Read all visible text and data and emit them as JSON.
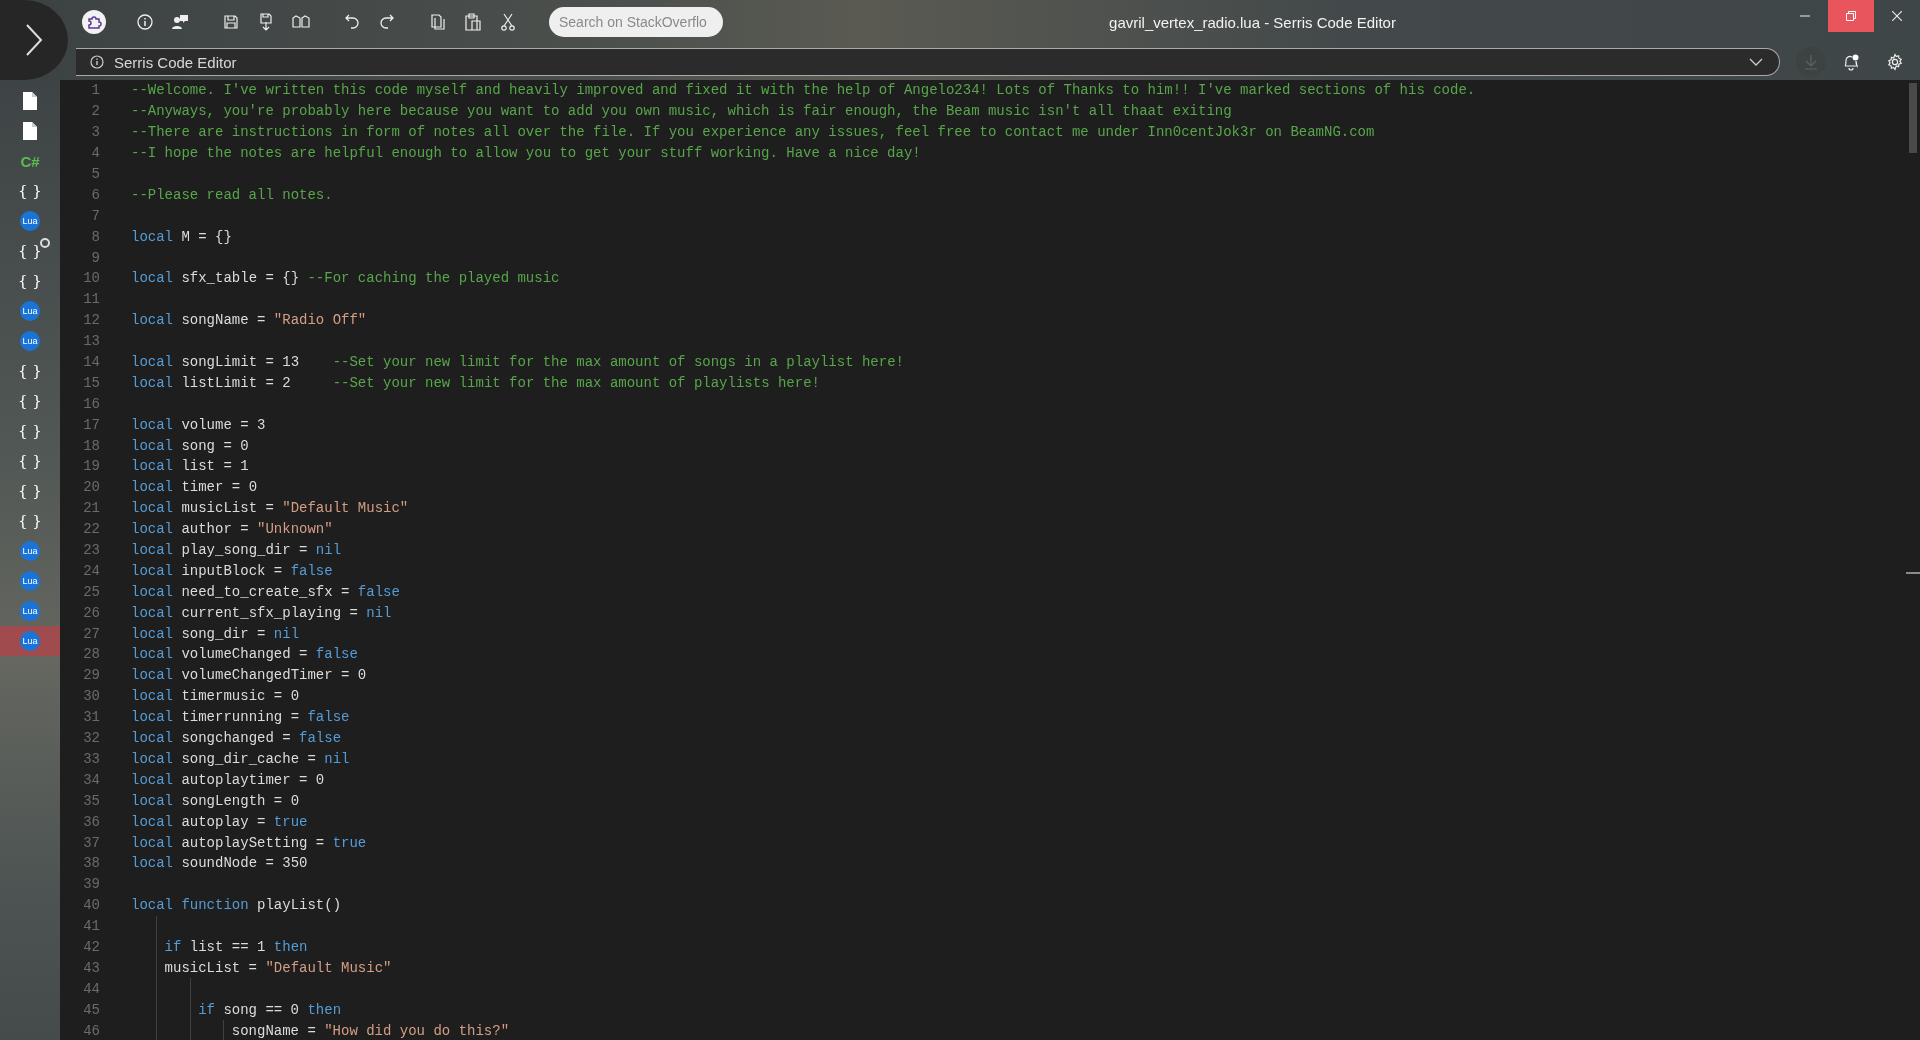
{
  "window": {
    "title": "gavril_vertex_radio.lua - Serris Code Editor"
  },
  "window_controls": [
    {
      "kind": "minimize",
      "hovered": false
    },
    {
      "kind": "restore",
      "hovered": true
    },
    {
      "kind": "close",
      "hovered": false
    }
  ],
  "toolbar": {
    "search": {
      "placeholder": "Search on StackOverflo"
    }
  },
  "address_bar": {
    "text": "Serris Code Editor"
  },
  "header_actions": {
    "download": {
      "disabled": true
    },
    "notifications": {
      "unread": true
    }
  },
  "sidebar": {
    "items": [
      {
        "kind": "file",
        "selected": false,
        "unsaved": false
      },
      {
        "kind": "file",
        "selected": false,
        "unsaved": false
      },
      {
        "kind": "csharp",
        "label": "C#",
        "selected": false,
        "unsaved": false
      },
      {
        "kind": "json",
        "label": "{ }",
        "selected": false,
        "unsaved": false
      },
      {
        "kind": "lua",
        "label": "Lua",
        "selected": false,
        "unsaved": false
      },
      {
        "kind": "json",
        "label": "{ }",
        "selected": false,
        "unsaved": true
      },
      {
        "kind": "json",
        "label": "{ }",
        "selected": false,
        "unsaved": false
      },
      {
        "kind": "lua",
        "label": "Lua",
        "selected": false,
        "unsaved": false
      },
      {
        "kind": "lua",
        "label": "Lua",
        "selected": false,
        "unsaved": false
      },
      {
        "kind": "json",
        "label": "{ }",
        "selected": false,
        "unsaved": false
      },
      {
        "kind": "json",
        "label": "{ }",
        "selected": false,
        "unsaved": false
      },
      {
        "kind": "json",
        "label": "{ }",
        "selected": false,
        "unsaved": false
      },
      {
        "kind": "json",
        "label": "{ }",
        "selected": false,
        "unsaved": false
      },
      {
        "kind": "json",
        "label": "{ }",
        "selected": false,
        "unsaved": false
      },
      {
        "kind": "json",
        "label": "{ }",
        "selected": false,
        "unsaved": false
      },
      {
        "kind": "lua",
        "label": "Lua",
        "selected": false,
        "unsaved": false
      },
      {
        "kind": "lua",
        "label": "Lua",
        "selected": false,
        "unsaved": false
      },
      {
        "kind": "lua",
        "label": "Lua",
        "selected": false,
        "unsaved": false
      },
      {
        "kind": "lua",
        "label": "Lua",
        "selected": true,
        "unsaved": false
      }
    ]
  },
  "editor": {
    "lines": [
      {
        "number": "1",
        "tokens": [
          {
            "kind": "comment",
            "text": "--Welcome. I've written this code myself and heavily improved and fixed it with the help of Angelo234! Lots of Thanks to him!! I've marked sections of his code."
          }
        ]
      },
      {
        "number": "2",
        "tokens": [
          {
            "kind": "comment",
            "text": "--Anyways, you're probably here because you want to add you own music, which is fair enough, the Beam music isn't all thaat exiting"
          }
        ]
      },
      {
        "number": "3",
        "tokens": [
          {
            "kind": "comment",
            "text": "--There are instructions in form of notes all over the file. If you experience any issues, feel free to contact me under Inn0centJok3r on BeamNG.com"
          }
        ]
      },
      {
        "number": "4",
        "tokens": [
          {
            "kind": "comment",
            "text": "--I hope the notes are helpful enough to allow you to get your stuff working. Have a nice day!"
          }
        ]
      },
      {
        "number": "5"
      },
      {
        "number": "6",
        "tokens": [
          {
            "kind": "comment",
            "text": "--Please read all notes."
          }
        ]
      },
      {
        "number": "7"
      },
      {
        "number": "8",
        "tokens": [
          {
            "kind": "keyword",
            "text": "local"
          },
          {
            "kind": "plain",
            "text": " M = {}"
          }
        ]
      },
      {
        "number": "9"
      },
      {
        "number": "10",
        "tokens": [
          {
            "kind": "keyword",
            "text": "local"
          },
          {
            "kind": "plain",
            "text": " sfx_table = {} "
          },
          {
            "kind": "comment",
            "text": "--For caching the played music"
          }
        ]
      },
      {
        "number": "11"
      },
      {
        "number": "12",
        "tokens": [
          {
            "kind": "keyword",
            "text": "local"
          },
          {
            "kind": "plain",
            "text": " songName = "
          },
          {
            "kind": "string",
            "text": "\"Radio Off\""
          }
        ]
      },
      {
        "number": "13"
      },
      {
        "number": "14",
        "tokens": [
          {
            "kind": "keyword",
            "text": "local"
          },
          {
            "kind": "plain",
            "text": " songLimit = 13    "
          },
          {
            "kind": "comment",
            "text": "--Set your new limit for the max amount of songs in a playlist here!"
          }
        ]
      },
      {
        "number": "15",
        "tokens": [
          {
            "kind": "keyword",
            "text": "local"
          },
          {
            "kind": "plain",
            "text": " listLimit = 2     "
          },
          {
            "kind": "comment",
            "text": "--Set your new limit for the max amount of playlists here!"
          }
        ]
      },
      {
        "number": "16"
      },
      {
        "number": "17",
        "tokens": [
          {
            "kind": "keyword",
            "text": "local"
          },
          {
            "kind": "plain",
            "text": " volume = 3"
          }
        ]
      },
      {
        "number": "18",
        "tokens": [
          {
            "kind": "keyword",
            "text": "local"
          },
          {
            "kind": "plain",
            "text": " song = 0"
          }
        ]
      },
      {
        "number": "19",
        "tokens": [
          {
            "kind": "keyword",
            "text": "local"
          },
          {
            "kind": "plain",
            "text": " list = 1"
          }
        ]
      },
      {
        "number": "20",
        "tokens": [
          {
            "kind": "keyword",
            "text": "local"
          },
          {
            "kind": "plain",
            "text": " timer = 0"
          }
        ]
      },
      {
        "number": "21",
        "tokens": [
          {
            "kind": "keyword",
            "text": "local"
          },
          {
            "kind": "plain",
            "text": " musicList = "
          },
          {
            "kind": "string",
            "text": "\"Default Music\""
          }
        ]
      },
      {
        "number": "22",
        "tokens": [
          {
            "kind": "keyword",
            "text": "local"
          },
          {
            "kind": "plain",
            "text": " author = "
          },
          {
            "kind": "string",
            "text": "\"Unknown\""
          }
        ]
      },
      {
        "number": "23",
        "tokens": [
          {
            "kind": "keyword",
            "text": "local"
          },
          {
            "kind": "plain",
            "text": " play_song_dir = "
          },
          {
            "kind": "keyword",
            "text": "nil"
          }
        ]
      },
      {
        "number": "24",
        "tokens": [
          {
            "kind": "keyword",
            "text": "local"
          },
          {
            "kind": "plain",
            "text": " inputBlock = "
          },
          {
            "kind": "keyword",
            "text": "false"
          }
        ]
      },
      {
        "number": "25",
        "tokens": [
          {
            "kind": "keyword",
            "text": "local"
          },
          {
            "kind": "plain",
            "text": " need_to_create_sfx = "
          },
          {
            "kind": "keyword",
            "text": "false"
          }
        ]
      },
      {
        "number": "26",
        "tokens": [
          {
            "kind": "keyword",
            "text": "local"
          },
          {
            "kind": "plain",
            "text": " current_sfx_playing = "
          },
          {
            "kind": "keyword",
            "text": "nil"
          }
        ]
      },
      {
        "number": "27",
        "tokens": [
          {
            "kind": "keyword",
            "text": "local"
          },
          {
            "kind": "plain",
            "text": " song_dir = "
          },
          {
            "kind": "keyword",
            "text": "nil"
          }
        ]
      },
      {
        "number": "28",
        "tokens": [
          {
            "kind": "keyword",
            "text": "local"
          },
          {
            "kind": "plain",
            "text": " volumeChanged = "
          },
          {
            "kind": "keyword",
            "text": "false"
          }
        ]
      },
      {
        "number": "29",
        "tokens": [
          {
            "kind": "keyword",
            "text": "local"
          },
          {
            "kind": "plain",
            "text": " volumeChangedTimer = 0"
          }
        ]
      },
      {
        "number": "30",
        "tokens": [
          {
            "kind": "keyword",
            "text": "local"
          },
          {
            "kind": "plain",
            "text": " timermusic = 0"
          }
        ]
      },
      {
        "number": "31",
        "tokens": [
          {
            "kind": "keyword",
            "text": "local"
          },
          {
            "kind": "plain",
            "text": " timerrunning = "
          },
          {
            "kind": "keyword",
            "text": "false"
          }
        ]
      },
      {
        "number": "32",
        "tokens": [
          {
            "kind": "keyword",
            "text": "local"
          },
          {
            "kind": "plain",
            "text": " songchanged = "
          },
          {
            "kind": "keyword",
            "text": "false"
          }
        ]
      },
      {
        "number": "33",
        "tokens": [
          {
            "kind": "keyword",
            "text": "local"
          },
          {
            "kind": "plain",
            "text": " song_dir_cache = "
          },
          {
            "kind": "keyword",
            "text": "nil"
          }
        ]
      },
      {
        "number": "34",
        "tokens": [
          {
            "kind": "keyword",
            "text": "local"
          },
          {
            "kind": "plain",
            "text": " autoplaytimer = 0"
          }
        ]
      },
      {
        "number": "35",
        "tokens": [
          {
            "kind": "keyword",
            "text": "local"
          },
          {
            "kind": "plain",
            "text": " songLength = 0"
          }
        ]
      },
      {
        "number": "36",
        "tokens": [
          {
            "kind": "keyword",
            "text": "local"
          },
          {
            "kind": "plain",
            "text": " autoplay = "
          },
          {
            "kind": "keyword",
            "text": "true"
          }
        ]
      },
      {
        "number": "37",
        "tokens": [
          {
            "kind": "keyword",
            "text": "local"
          },
          {
            "kind": "plain",
            "text": " autoplaySetting = "
          },
          {
            "kind": "keyword",
            "text": "true"
          }
        ]
      },
      {
        "number": "38",
        "tokens": [
          {
            "kind": "keyword",
            "text": "local"
          },
          {
            "kind": "plain",
            "text": " soundNode = 350"
          }
        ]
      },
      {
        "number": "39"
      },
      {
        "number": "40",
        "tokens": [
          {
            "kind": "keyword",
            "text": "local function"
          },
          {
            "kind": "plain",
            "text": " playList()"
          }
        ],
        "children": [
          {
            "number": "41"
          },
          {
            "number": "42",
            "tokens": [
              {
                "kind": "keyword",
                "text": "if"
              },
              {
                "kind": "plain",
                "text": " list == 1 "
              },
              {
                "kind": "keyword",
                "text": "then"
              }
            ]
          },
          {
            "number": "43",
            "tokens": [
              {
                "kind": "plain",
                "text": "musicList = "
              },
              {
                "kind": "string",
                "text": "\"Default Music\""
              }
            ],
            "children": [
              {
                "number": "44"
              },
              {
                "number": "45",
                "tokens": [
                  {
                    "kind": "keyword",
                    "text": "if"
                  },
                  {
                    "kind": "plain",
                    "text": " song == 0 "
                  },
                  {
                    "kind": "keyword",
                    "text": "then"
                  }
                ],
                "children": [
                  {
                    "number": "46",
                    "tokens": [
                      {
                        "kind": "plain",
                        "text": "songName = "
                      },
                      {
                        "kind": "string",
                        "text": "\"How did you do this?\""
                      }
                    ]
                  }
                ]
              }
            ]
          }
        ]
      }
    ]
  }
}
